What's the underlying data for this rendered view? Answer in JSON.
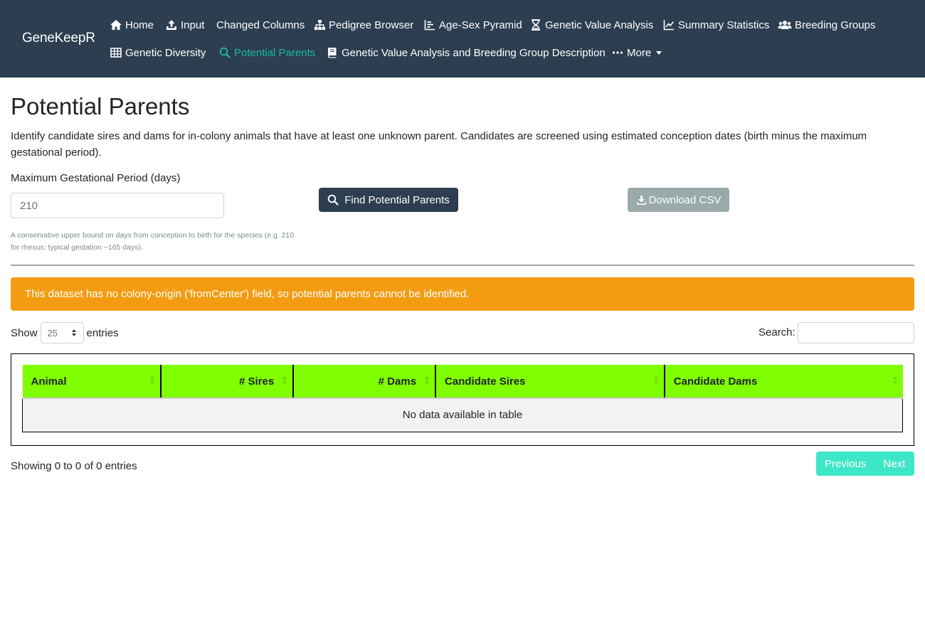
{
  "brand": "GeneKeepR",
  "nav": {
    "home": "Home",
    "input": "Input",
    "changed_columns": "Changed Columns",
    "pedigree_browser": "Pedigree Browser",
    "age_sex_pyramid": "Age-Sex Pyramid",
    "genetic_value_analysis": "Genetic Value Analysis",
    "summary_statistics": "Summary Statistics",
    "breeding_groups": "Breeding Groups",
    "genetic_diversity": "Genetic Diversity",
    "potential_parents": "Potential Parents",
    "gva_description": "Genetic Value Analysis and Breeding Group Description",
    "more": "More",
    "active": "potential_parents"
  },
  "page": {
    "title": "Potential Parents",
    "description": "Identify candidate sires and dams for in-colony animals that have at least one unknown parent. Candidates are screened using estimated conception dates (birth minus the maximum gestational period)."
  },
  "form": {
    "gestation_label": "Maximum Gestational Period (days)",
    "gestation_value": "210",
    "help_text": "A conservative upper bound on days from conception to birth for the species (e.g. 210 for rhesus; typical gestation ~165 days).",
    "find_button": "Find Potential Parents",
    "download_button": "Download CSV"
  },
  "alert": {
    "message": "This dataset has no colony-origin ('fromCenter') field, so potential parents cannot be identified.",
    "color": "#f39c12"
  },
  "table_controls": {
    "show_label": "Show",
    "entries_value": "25",
    "entries_label": "entries",
    "search_label": "Search:",
    "search_value": ""
  },
  "table": {
    "columns": [
      "Animal",
      "# Sires",
      "# Dams",
      "Candidate Sires",
      "Candidate Dams"
    ],
    "rows": [],
    "empty_message": "No data available in table",
    "header_color": "#7fff00"
  },
  "footer": {
    "info": "Showing 0 to 0 of 0 entries",
    "previous": "Previous",
    "next": "Next"
  },
  "colors": {
    "navbar": "#2c3e50",
    "active_nav": "#1abc9c",
    "primary_button": "#2c3e50",
    "secondary_button": "#95a5a6",
    "pager": "#3ee6c8"
  }
}
